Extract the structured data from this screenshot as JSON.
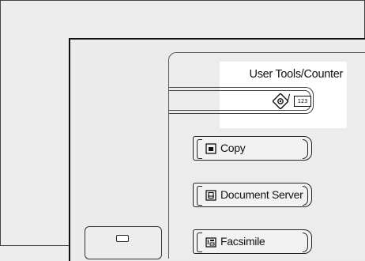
{
  "user_tools": {
    "label": "User Tools/Counter",
    "counter_icon_text": "123",
    "slash": "/",
    "icon": "user-tools-diamond-icon"
  },
  "function_keys": [
    {
      "label": "Copy",
      "icon": "copy-icon"
    },
    {
      "label": "Document Server",
      "icon": "document-server-icon"
    },
    {
      "label": "Facsimile",
      "icon": "facsimile-icon"
    }
  ],
  "colors": {
    "background": "#ededed",
    "highlight": "#ffffff",
    "line": "#222222"
  }
}
